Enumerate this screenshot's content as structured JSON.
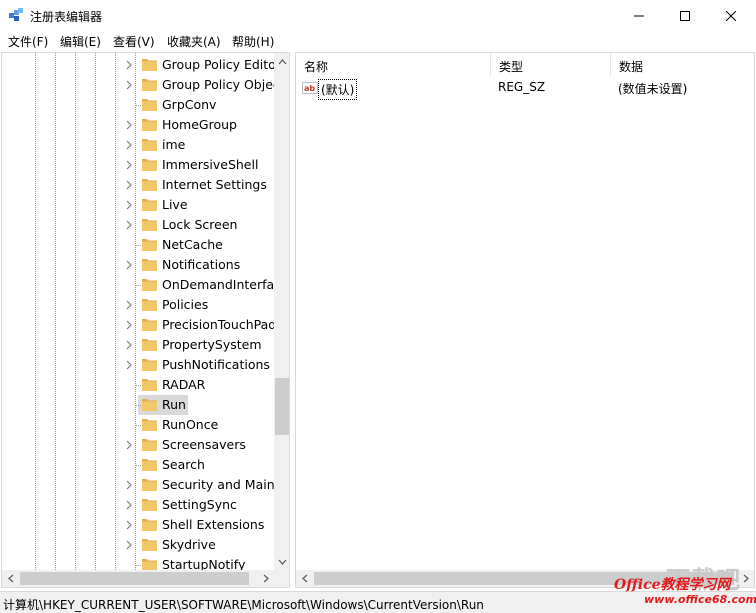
{
  "window": {
    "title": "注册表编辑器",
    "controls": {
      "minimize": "minimize",
      "maximize": "maximize",
      "close": "close"
    }
  },
  "menu": [
    "文件(F)",
    "编辑(E)",
    "查看(V)",
    "收藏夹(A)",
    "帮助(H)"
  ],
  "tree": {
    "items": [
      {
        "label": "Group Policy Editor",
        "expandable": true
      },
      {
        "label": "Group Policy Objects",
        "expandable": true
      },
      {
        "label": "GrpConv",
        "expandable": false
      },
      {
        "label": "HomeGroup",
        "expandable": true
      },
      {
        "label": "ime",
        "expandable": true
      },
      {
        "label": "ImmersiveShell",
        "expandable": true
      },
      {
        "label": "Internet Settings",
        "expandable": true
      },
      {
        "label": "Live",
        "expandable": true
      },
      {
        "label": "Lock Screen",
        "expandable": true
      },
      {
        "label": "NetCache",
        "expandable": false
      },
      {
        "label": "Notifications",
        "expandable": true
      },
      {
        "label": "OnDemandInterfaceCache",
        "expandable": false
      },
      {
        "label": "Policies",
        "expandable": true
      },
      {
        "label": "PrecisionTouchPad",
        "expandable": true
      },
      {
        "label": "PropertySystem",
        "expandable": true
      },
      {
        "label": "PushNotifications",
        "expandable": true
      },
      {
        "label": "RADAR",
        "expandable": false
      },
      {
        "label": "Run",
        "expandable": false,
        "selected": true
      },
      {
        "label": "RunOnce",
        "expandable": false
      },
      {
        "label": "Screensavers",
        "expandable": true
      },
      {
        "label": "Search",
        "expandable": false
      },
      {
        "label": "Security and Maintenance",
        "expandable": true
      },
      {
        "label": "SettingSync",
        "expandable": true
      },
      {
        "label": "Shell Extensions",
        "expandable": true
      },
      {
        "label": "Skydrive",
        "expandable": true
      },
      {
        "label": "StartupNotify",
        "expandable": false
      }
    ]
  },
  "values": {
    "columns": {
      "name": "名称",
      "type": "类型",
      "data": "数据"
    },
    "rows": [
      {
        "name": "(默认)",
        "type": "REG_SZ",
        "data": "(数值未设置)",
        "icon": "string-value-icon"
      }
    ]
  },
  "status": {
    "path": "计算机\\HKEY_CURRENT_USER\\SOFTWARE\\Microsoft\\Windows\\CurrentVersion\\Run"
  },
  "watermark": {
    "big": "下载吧",
    "brand": "Office教程学习网",
    "url": "www.office68.com"
  },
  "colors": {
    "folder": "#f3c868",
    "selection": "#d9d9d9",
    "scrollbar_thumb": "#cdcdcd",
    "watermark_red": "#e01b1b"
  }
}
